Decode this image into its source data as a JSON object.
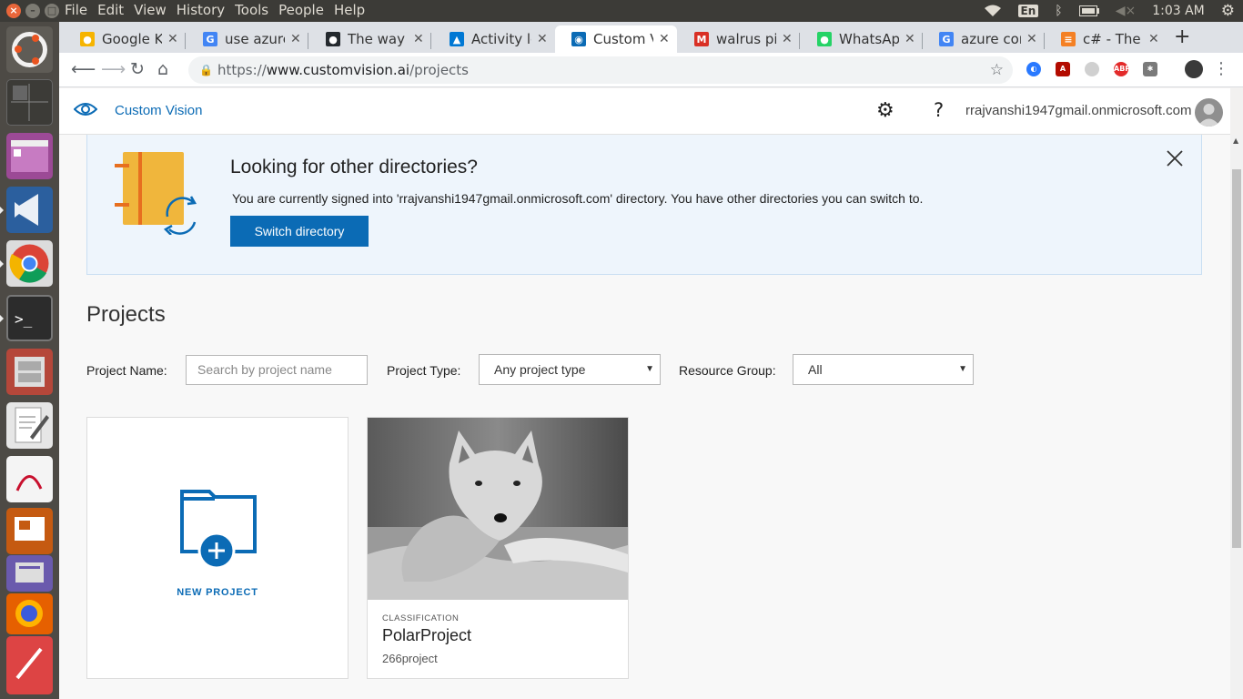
{
  "ubuntu": {
    "menus": [
      "File",
      "Edit",
      "View",
      "History",
      "Tools",
      "People",
      "Help"
    ],
    "keyboard": "En",
    "clock": "1:03 AM"
  },
  "tabs": [
    {
      "label": "Google Ke",
      "color": "#f6b400",
      "glyph": "●"
    },
    {
      "label": "use azure",
      "color": "#4285f4",
      "glyph": "G"
    },
    {
      "label": "The way to",
      "color": "#24292e",
      "glyph": "●"
    },
    {
      "label": "Activity lo",
      "color": "#0078d4",
      "glyph": "▲"
    },
    {
      "label": "Custom Vi",
      "color": "#0b6bb5",
      "glyph": "◉"
    },
    {
      "label": "walrus pic",
      "color": "#d93025",
      "glyph": "M"
    },
    {
      "label": "WhatsApp",
      "color": "#25d366",
      "glyph": "●"
    },
    {
      "label": "azure conf",
      "color": "#4285f4",
      "glyph": "G"
    },
    {
      "label": "c# - The sp",
      "color": "#f48024",
      "glyph": "≡"
    }
  ],
  "address": {
    "scheme": "https://",
    "host": "www.customvision.ai",
    "path": "/projects"
  },
  "header": {
    "brand": "Custom Vision",
    "help": "?",
    "user": "rrajvanshi1947gmail.onmicrosoft.com"
  },
  "banner": {
    "title": "Looking for other directories?",
    "text": "You are currently signed into 'rrajvanshi1947gmail.onmicrosoft.com' directory. You have other directories you can switch to.",
    "button": "Switch directory"
  },
  "projects": {
    "title": "Projects",
    "name_label": "Project Name:",
    "name_placeholder": "Search by project name",
    "type_label": "Project Type:",
    "type_value": "Any project type",
    "group_label": "Resource Group:",
    "group_value": "All",
    "new_project": "NEW PROJECT",
    "cards": [
      {
        "type": "CLASSIFICATION",
        "name": "PolarProject",
        "description": "266project"
      }
    ]
  }
}
